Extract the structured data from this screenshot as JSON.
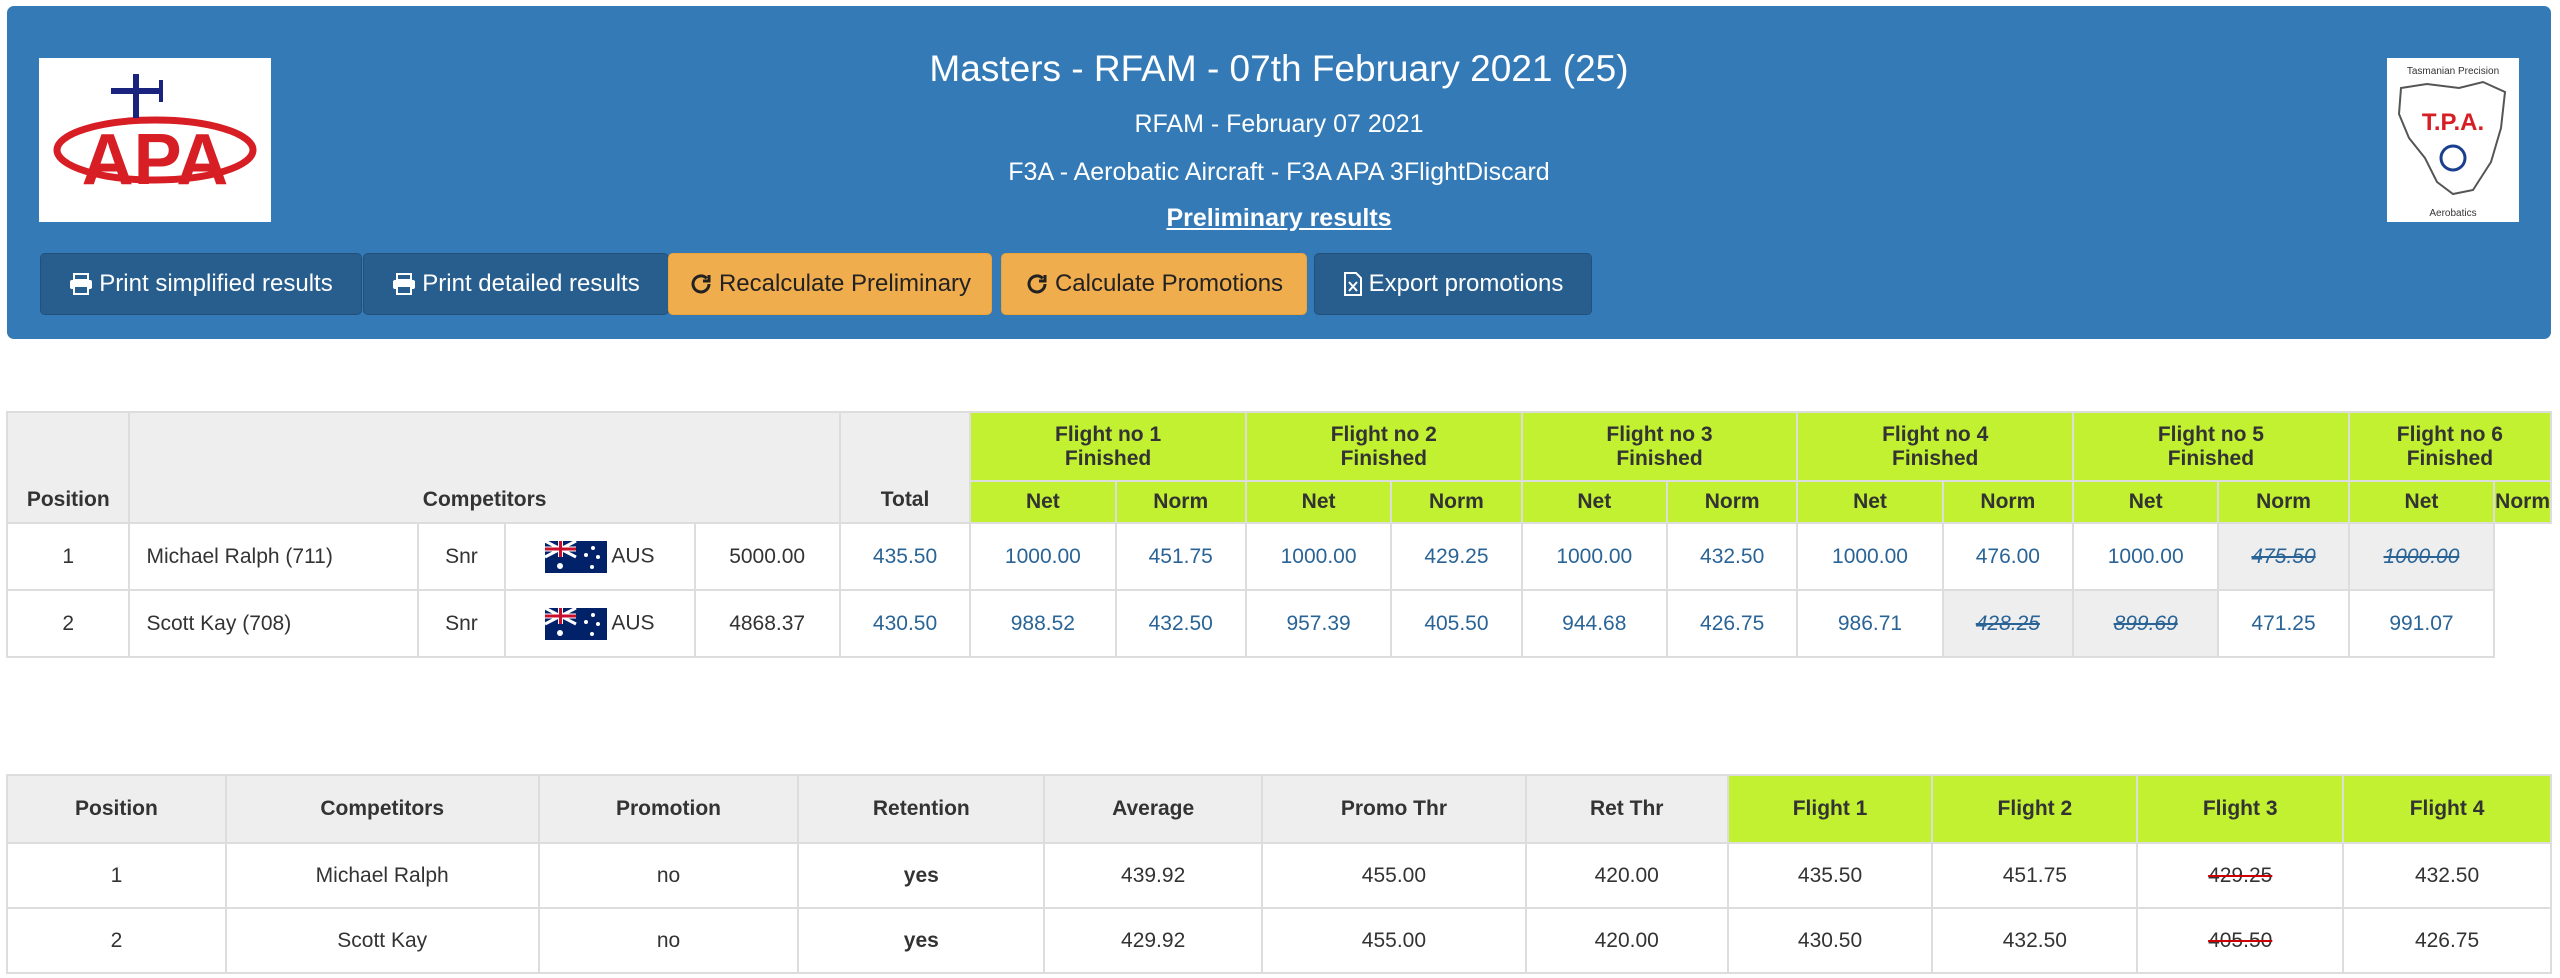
{
  "header": {
    "title": "Masters - RFAM - 07th February 2021 (25)",
    "subtitle": "RFAM - February 07 2021",
    "class_line": "F3A - Aerobatic Aircraft - F3A APA 3FlightDiscard",
    "results_link": "Preliminary results",
    "logo_left_text": "APA",
    "logo_right_text": "T.P.A.",
    "logo_right_top": "Tasmanian Precision",
    "logo_right_bottom": "Aerobatics"
  },
  "buttons": {
    "print_simplified": "Print simplified results",
    "print_detailed": "Print detailed results",
    "recalc_prelim": "Recalculate Preliminary",
    "calc_promotions": "Calculate Promotions",
    "export_promotions": "Export promotions"
  },
  "colors": {
    "header": "#337ab7",
    "flight_header": "#c1f130",
    "orange": "#f0ad4e"
  },
  "results_table": {
    "headers": {
      "position": "Position",
      "competitors": "Competitors",
      "total": "Total",
      "net": "Net",
      "norm": "Norm"
    },
    "flights": [
      {
        "name": "Flight no 1",
        "status": "Finished"
      },
      {
        "name": "Flight no 2",
        "status": "Finished"
      },
      {
        "name": "Flight no 3",
        "status": "Finished"
      },
      {
        "name": "Flight no 4",
        "status": "Finished"
      },
      {
        "name": "Flight no 5",
        "status": "Finished"
      },
      {
        "name": "Flight no 6",
        "status": "Finished"
      }
    ],
    "rows": [
      {
        "position": "1",
        "name": "Michael Ralph (711)",
        "category": "Snr",
        "country": "AUS",
        "total": "5000.00",
        "scores": [
          {
            "net": "435.50",
            "norm": "1000.00"
          },
          {
            "net": "451.75",
            "norm": "1000.00"
          },
          {
            "net": "429.25",
            "norm": "1000.00"
          },
          {
            "net": "432.50",
            "norm": "1000.00"
          },
          {
            "net": "476.00",
            "norm": "1000.00"
          },
          {
            "net": "475.50",
            "norm": "1000.00",
            "discarded": true
          }
        ]
      },
      {
        "position": "2",
        "name": "Scott Kay (708)",
        "category": "Snr",
        "country": "AUS",
        "total": "4868.37",
        "scores": [
          {
            "net": "430.50",
            "norm": "988.52"
          },
          {
            "net": "432.50",
            "norm": "957.39"
          },
          {
            "net": "405.50",
            "norm": "944.68"
          },
          {
            "net": "426.75",
            "norm": "986.71"
          },
          {
            "net": "428.25",
            "norm": "899.69",
            "discarded": true
          },
          {
            "net": "471.25",
            "norm": "991.07"
          }
        ]
      }
    ]
  },
  "promo_table": {
    "headers": [
      "Position",
      "Competitors",
      "Promotion",
      "Retention",
      "Average",
      "Promo Thr",
      "Ret Thr",
      "Flight 1",
      "Flight 2",
      "Flight 3",
      "Flight 4"
    ],
    "rows": [
      {
        "position": "1",
        "name": "Michael Ralph",
        "promotion": "no",
        "retention": "yes",
        "average": "439.92",
        "promo_thr": "455.00",
        "ret_thr": "420.00",
        "flights": [
          "435.50",
          "451.75",
          "429.25",
          "432.50"
        ]
      },
      {
        "position": "2",
        "name": "Scott Kay",
        "promotion": "no",
        "retention": "yes",
        "average": "429.92",
        "promo_thr": "455.00",
        "ret_thr": "420.00",
        "flights": [
          "430.50",
          "432.50",
          "405.50",
          "426.75"
        ]
      }
    ]
  }
}
